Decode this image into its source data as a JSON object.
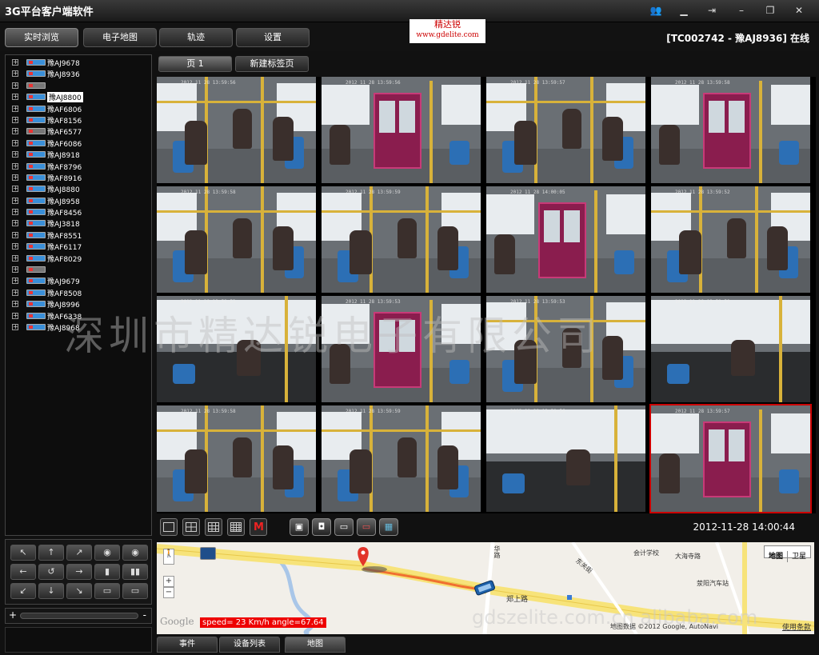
{
  "app": {
    "title": "3G平台客户端软件",
    "window_buttons": [
      "users-icon",
      "minimize-icon",
      "window-icon",
      "restore-icon",
      "close-icon"
    ]
  },
  "nav": {
    "tabs": [
      {
        "label": "实时浏览",
        "active": true
      },
      {
        "label": "电子地图",
        "active": false
      },
      {
        "label": "轨迹",
        "active": false
      },
      {
        "label": "设置",
        "active": false
      }
    ],
    "status": "[TC002742 - 豫AJ8936] 在线"
  },
  "logo": {
    "name": "精达锐",
    "url": "www.gdelite.com"
  },
  "device_tree": [
    {
      "label": "豫AJ9678",
      "icon": "blue",
      "selected": false
    },
    {
      "label": "豫AJ8936",
      "icon": "blue",
      "selected": false
    },
    {
      "label": "",
      "icon": "gray",
      "selected": false
    },
    {
      "label": "豫AJ8800",
      "icon": "blue",
      "selected": true
    },
    {
      "label": "豫AF6806",
      "icon": "blue",
      "selected": false
    },
    {
      "label": "豫AF8156",
      "icon": "blue",
      "selected": false
    },
    {
      "label": "豫AF6577",
      "icon": "gray",
      "selected": false
    },
    {
      "label": "豫AF6086",
      "icon": "blue",
      "selected": false
    },
    {
      "label": "豫AJ8918",
      "icon": "blue",
      "selected": false
    },
    {
      "label": "豫AF8796",
      "icon": "blue",
      "selected": false
    },
    {
      "label": "豫AF8916",
      "icon": "blue",
      "selected": false
    },
    {
      "label": "豫AJ8880",
      "icon": "blue",
      "selected": false
    },
    {
      "label": "豫AJ8958",
      "icon": "blue",
      "selected": false
    },
    {
      "label": "豫AF8456",
      "icon": "blue",
      "selected": false
    },
    {
      "label": "豫AJ3818",
      "icon": "blue",
      "selected": false
    },
    {
      "label": "豫AF8551",
      "icon": "blue",
      "selected": false
    },
    {
      "label": "豫AF6117",
      "icon": "blue",
      "selected": false
    },
    {
      "label": "豫AF8029",
      "icon": "blue",
      "selected": false
    },
    {
      "label": "",
      "icon": "gray",
      "selected": false
    },
    {
      "label": "豫AJ9679",
      "icon": "blue",
      "selected": false
    },
    {
      "label": "豫AF8508",
      "icon": "blue",
      "selected": false
    },
    {
      "label": "豫AJ8996",
      "icon": "blue",
      "selected": false
    },
    {
      "label": "豫AF6338",
      "icon": "blue",
      "selected": false
    },
    {
      "label": "豫AJ8968",
      "icon": "blue",
      "selected": false
    }
  ],
  "ptz": {
    "buttons": [
      "↖",
      "↑",
      "↗",
      "◉",
      "◉",
      "←",
      "↺",
      "→",
      "▮",
      "▮▮",
      "↙",
      "↓",
      "↘",
      "▭",
      "▭"
    ]
  },
  "volume": {
    "minus": "+",
    "plus": "-"
  },
  "page_tabs": [
    {
      "label": "页 1",
      "active": true
    },
    {
      "label": "新建标签页",
      "active": false
    }
  ],
  "video_grid": {
    "highlighted_index": 15,
    "cameras": [
      {
        "timestamp": "2012 11 28  13:59:56",
        "scene": "aisle"
      },
      {
        "timestamp": "2012 11 28  13:59:56",
        "scene": "door"
      },
      {
        "timestamp": "2012 11 28  13:59:57",
        "scene": "aisle"
      },
      {
        "timestamp": "2012 11 28  13:59:58",
        "scene": "door"
      },
      {
        "timestamp": "2012 11 28  13:59:58",
        "scene": "aisle"
      },
      {
        "timestamp": "2012 11 28  13:59:59",
        "scene": "aisle"
      },
      {
        "timestamp": "2012 11 28  14:00:05",
        "scene": "door"
      },
      {
        "timestamp": "2012 11 28  13:59:52",
        "scene": "aisle"
      },
      {
        "timestamp": "2012 11 28  13:59:53",
        "scene": "front"
      },
      {
        "timestamp": "2012 11 28  13:59:53",
        "scene": "door"
      },
      {
        "timestamp": "2012 11 28  13:59:53",
        "scene": "aisle"
      },
      {
        "timestamp": "2012 11 28  13:59:59",
        "scene": "front"
      },
      {
        "timestamp": "2012 11 28  13:59:58",
        "scene": "aisle"
      },
      {
        "timestamp": "2012 11 28  13:59:59",
        "scene": "aisle"
      },
      {
        "timestamp": "2012 11 28  13:59:56",
        "scene": "front"
      },
      {
        "timestamp": "2012 11 28  13:59:57",
        "scene": "door"
      }
    ]
  },
  "toolbar": {
    "layouts": [
      "layout-1x1",
      "layout-2x2",
      "layout-3x3",
      "layout-4x4",
      "layout-full"
    ],
    "tools": [
      "snapshot-icon",
      "record-icon",
      "talk-icon",
      "listen-icon",
      "map-icon"
    ],
    "tool_glyphs": [
      "▣",
      "◘",
      "▭",
      "▭",
      "▦"
    ],
    "datetime": "2012-11-28 14:00:44"
  },
  "map": {
    "labels": [
      {
        "text": "会计学校",
        "pos": "top-right"
      },
      {
        "text": "大海寺路",
        "pos": "top-right"
      },
      {
        "text": "荥阳汽车站",
        "pos": "right"
      },
      {
        "text": "东关街",
        "pos": "center"
      },
      {
        "text": "郑上路",
        "pos": "center"
      },
      {
        "text": "华路",
        "pos": "left"
      }
    ],
    "map_types": [
      {
        "label": "地图",
        "active": true
      },
      {
        "label": "卫星",
        "active": false
      }
    ],
    "speed_text": "speed= 23 Km/h angle=67.64",
    "google": "Google",
    "copyright": "地图数据 ©2012 Google, AutoNavi",
    "terms": "使用条款",
    "zoom_in": "+",
    "zoom_out": "−"
  },
  "bottom_tabs": [
    {
      "label": "事件",
      "active": false
    },
    {
      "label": "设备列表",
      "active": false
    },
    {
      "label": "地图",
      "active": true
    }
  ],
  "watermark": {
    "text": "深圳市精达锐电子有限公司",
    "url": "gdszelite.com.cn  alibaba.com"
  },
  "colors": {
    "accent_red": "#cc0000",
    "device_blue": "#3a8fd8",
    "route_orange": "#f07030",
    "bus_pole_yellow": "#d8b23a",
    "door_magenta": "#8a1d4e"
  }
}
